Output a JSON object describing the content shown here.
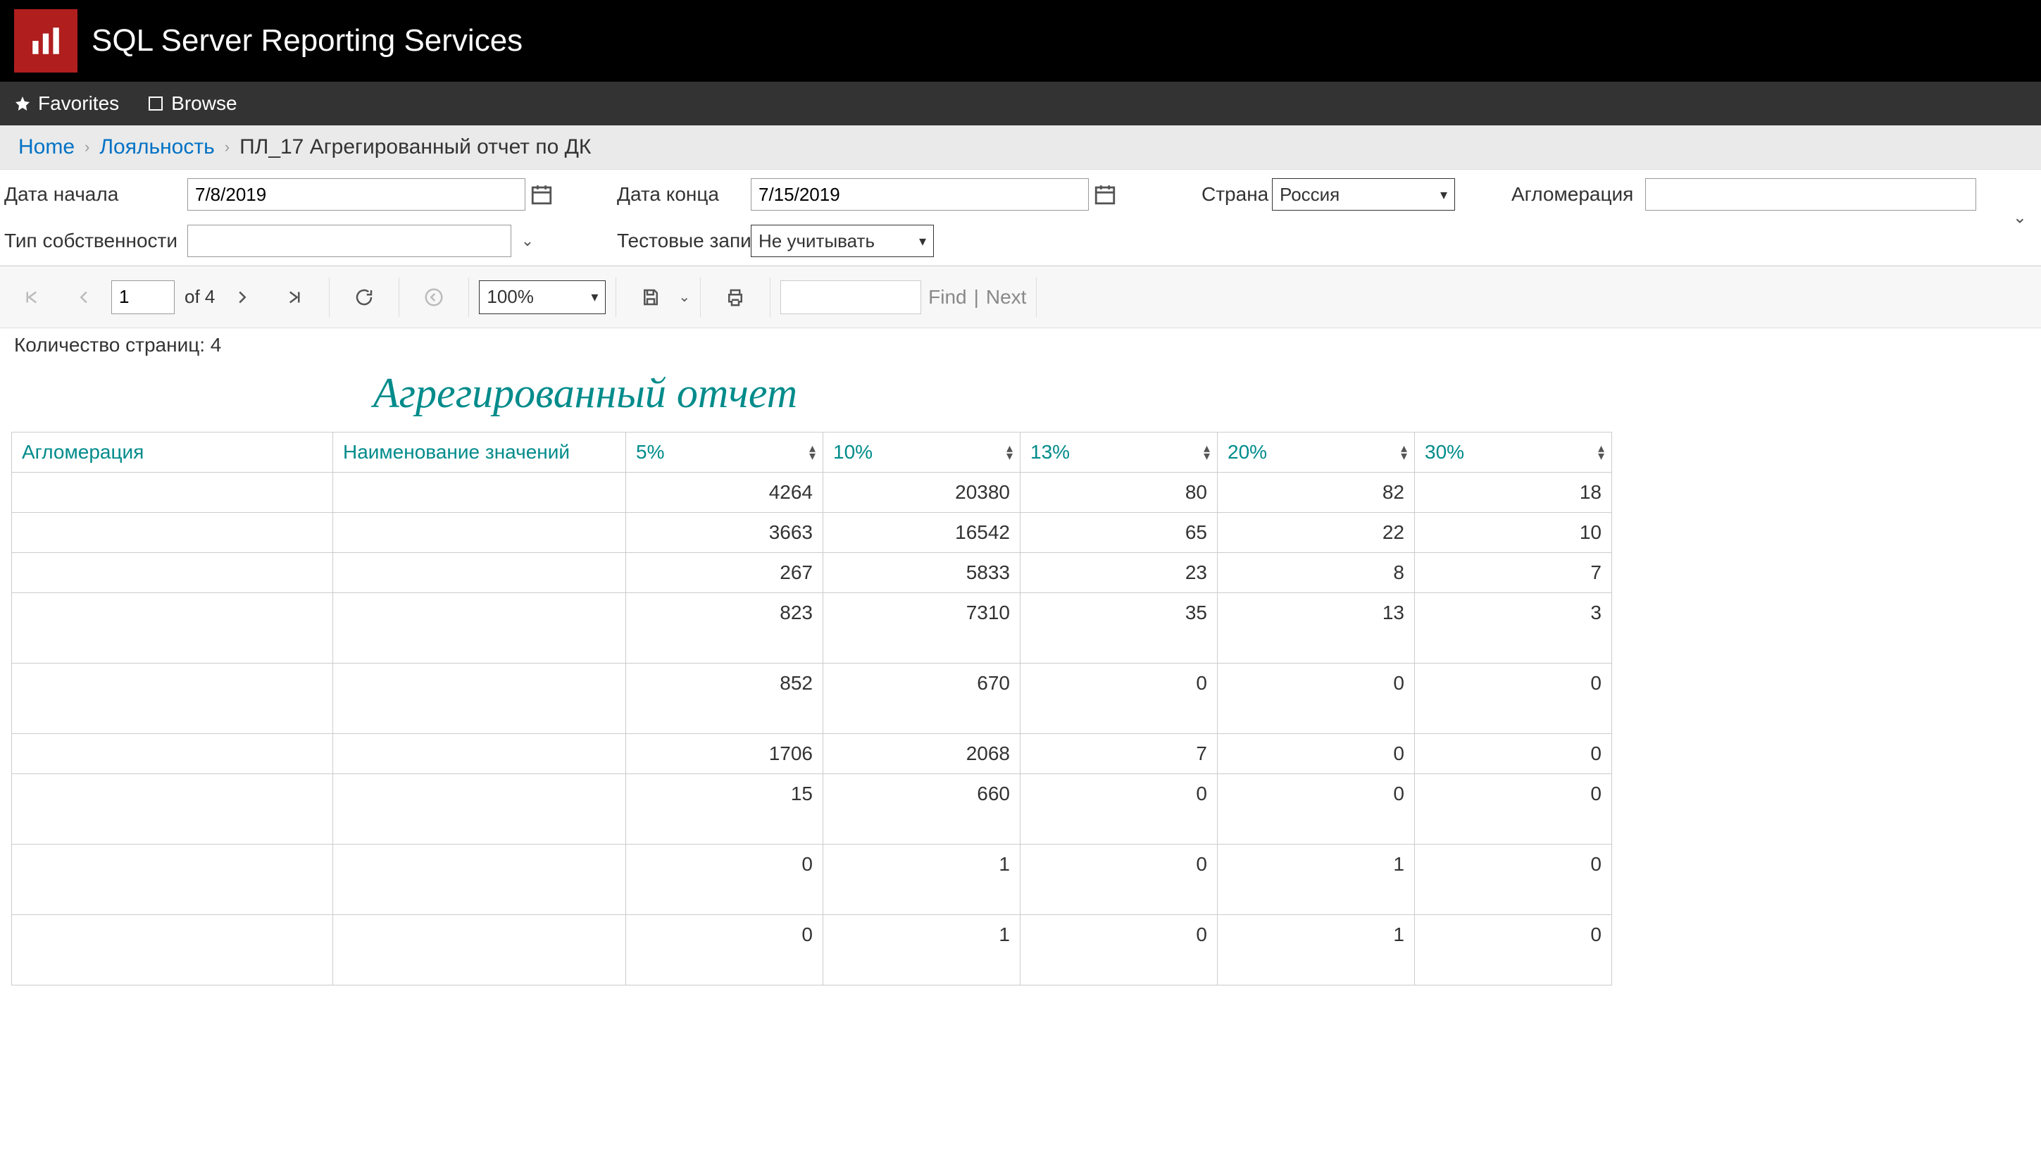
{
  "app_title": "SQL Server Reporting Services",
  "subheader": {
    "favorites": "Favorites",
    "browse": "Browse"
  },
  "breadcrumb": {
    "home": "Home",
    "loyalty": "Лояльность",
    "current": "ПЛ_17 Агрегированный отчет по ДК"
  },
  "params": {
    "date_start_label": "Дата начала",
    "date_start_value": "7/8/2019",
    "date_end_label": "Дата конца",
    "date_end_value": "7/15/2019",
    "country_label": "Страна",
    "country_value": "Россия",
    "aglomeration_label": "Агломерация",
    "aglomeration_value": "",
    "ownership_label": "Тип собственности",
    "ownership_value": "",
    "test_label": "Тестовые записи",
    "test_value": "Не учитывать"
  },
  "toolbar": {
    "page_current": "1",
    "page_of": "of 4",
    "zoom": "100%",
    "find_label": "Find",
    "next_label": "Next"
  },
  "page_count_text": "Количество страниц: 4",
  "report_title": "Агрегированный отчет",
  "columns": {
    "aglomeration": "Агломерация",
    "name": "Наименование значений",
    "p5": "5%",
    "p10": "10%",
    "p13": "13%",
    "p20": "20%",
    "p30": "30%"
  },
  "rows": [
    {
      "p5": "4264",
      "p10": "20380",
      "p13": "80",
      "p20": "82",
      "p30": "18"
    },
    {
      "p5": "3663",
      "p10": "16542",
      "p13": "65",
      "p20": "22",
      "p30": "10"
    },
    {
      "p5": "267",
      "p10": "5833",
      "p13": "23",
      "p20": "8",
      "p30": "7"
    },
    {
      "p5": "823",
      "p10": "7310",
      "p13": "35",
      "p20": "13",
      "p30": "3"
    },
    {
      "p5": "852",
      "p10": "670",
      "p13": "0",
      "p20": "0",
      "p30": "0"
    },
    {
      "p5": "1706",
      "p10": "2068",
      "p13": "7",
      "p20": "0",
      "p30": "0"
    },
    {
      "p5": "15",
      "p10": "660",
      "p13": "0",
      "p20": "0",
      "p30": "0"
    },
    {
      "p5": "0",
      "p10": "1",
      "p13": "0",
      "p20": "1",
      "p30": "0"
    },
    {
      "p5": "0",
      "p10": "1",
      "p13": "0",
      "p20": "1",
      "p30": "0"
    }
  ]
}
